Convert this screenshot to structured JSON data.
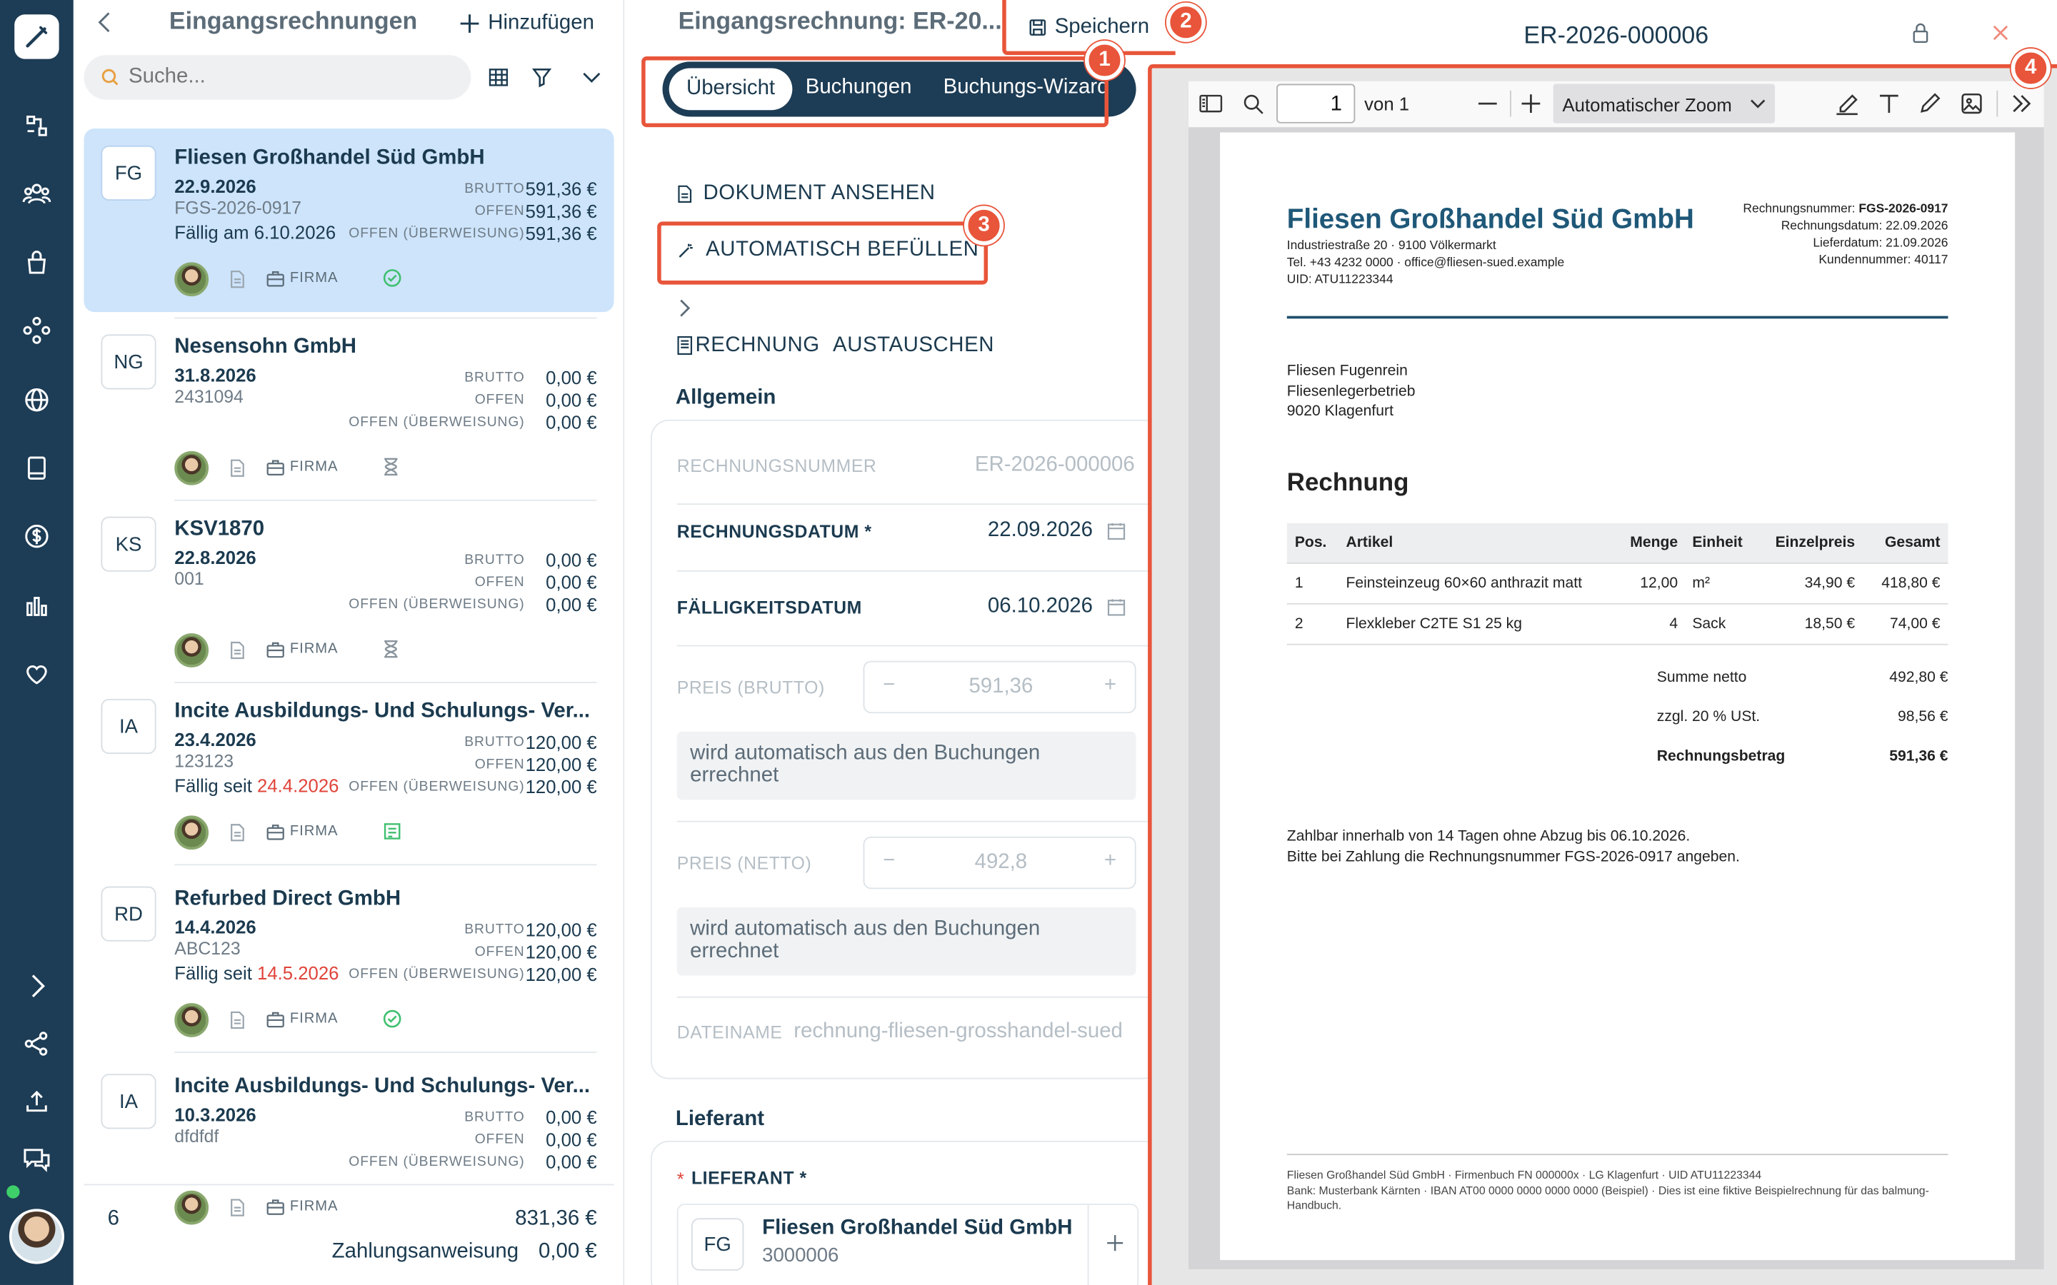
{
  "list": {
    "title": "Eingangsrechnungen",
    "add_label": "Hinzufügen",
    "search_placeholder": "Suche...",
    "items": [
      {
        "mono": "FG",
        "name": "Fliesen Großhandel Süd GmbH",
        "date": "22.9.2026",
        "number": "FGS-2026-0917",
        "due_prefix": "Fällig am 6.10.2026",
        "due_date": "",
        "brutto": "591,36 €",
        "offen": "591,36 €",
        "ueberweisung": "591,36 €",
        "tag": "FIRMA",
        "status": "check-circle-icon"
      },
      {
        "mono": "NG",
        "name": "Nesensohn GmbH",
        "date": "31.8.2026",
        "number": "2431094",
        "due_prefix": "",
        "due_date": "",
        "brutto": "0,00 €",
        "offen": "0,00 €",
        "ueberweisung": "0,00 €",
        "tag": "FIRMA",
        "status": "hourglass-icon"
      },
      {
        "mono": "KS",
        "name": "KSV1870",
        "date": "22.8.2026",
        "number": "001",
        "due_prefix": "",
        "due_date": "",
        "brutto": "0,00 €",
        "offen": "0,00 €",
        "ueberweisung": "0,00 €",
        "tag": "FIRMA",
        "status": "hourglass-icon"
      },
      {
        "mono": "IA",
        "name": "Incite Ausbildungs- Und Schulungs- Ver...",
        "date": "23.4.2026",
        "number": "123123",
        "due_prefix": "Fällig seit ",
        "due_date": "24.4.2026",
        "brutto": "120,00 €",
        "offen": "120,00 €",
        "ueberweisung": "120,00 €",
        "tag": "FIRMA",
        "status": "booked-icon"
      },
      {
        "mono": "RD",
        "name": "Refurbed Direct GmbH",
        "date": "14.4.2026",
        "number": "ABC123",
        "due_prefix": "Fällig seit ",
        "due_date": "14.5.2026",
        "brutto": "120,00 €",
        "offen": "120,00 €",
        "ueberweisung": "120,00 €",
        "tag": "FIRMA",
        "status": "check-circle-icon"
      },
      {
        "mono": "IA",
        "name": "Incite Ausbildungs- Und Schulungs- Ver...",
        "date": "10.3.2026",
        "number": "dfdfdf",
        "due_prefix": "",
        "due_date": "",
        "brutto": "0,00 €",
        "offen": "0,00 €",
        "ueberweisung": "0,00 €",
        "tag": "FIRMA",
        "status": ""
      }
    ],
    "amount_labels": {
      "brutto": "BRUTTO",
      "offen": "OFFEN",
      "ueberweisung": "OFFEN (ÜBERWEISUNG)"
    },
    "footer": {
      "count": "6",
      "total": "831,36 €",
      "payment_label": "Zahlungsanweisung",
      "payment_value": "0,00 €"
    }
  },
  "detail": {
    "title": "Eingangsrechnung: ER-20...",
    "save_label": "Speichern",
    "tabs": [
      "Übersicht",
      "Buchungen",
      "Buchungs-Wizard"
    ],
    "active_tab": "Übersicht",
    "actions": {
      "view_document": "DOKUMENT ANSEHEN",
      "autofill": "AUTOMATISCH BEFÜLLEN",
      "replace_1": "RECHNUNG",
      "replace_2": "AUSTAUSCHEN"
    },
    "section_general": "Allgemein",
    "fields": {
      "invoice_number_label": "RECHNUNGSNUMMER",
      "invoice_number": "ER-2026-000006",
      "invoice_date_label": "RECHNUNGSDATUM *",
      "invoice_date": "22.09.2026",
      "due_date_label": "FÄLLIGKEITSDATUM",
      "due_date": "06.10.2026",
      "gross_label": "PREIS (BRUTTO)",
      "gross": "591,36",
      "net_label": "PREIS (NETTO)",
      "net": "492,8",
      "auto_hint": "wird automatisch aus den Buchungen errechnet",
      "filename_label": "DATEINAME",
      "filename": "rechnung-fliesen-grosshandel-sued"
    },
    "section_supplier": "Lieferant",
    "supplier_label": "LIEFERANT *",
    "supplier": {
      "mono": "FG",
      "name": "Fliesen Großhandel Süd GmbH",
      "number": "3000006"
    }
  },
  "annotations": [
    "1",
    "2",
    "3",
    "4"
  ],
  "viewer": {
    "title": "ER-2026-000006",
    "page_input": "1",
    "page_of": "von 1",
    "zoom": "Automatischer Zoom"
  },
  "invoice": {
    "company": "Fliesen Großhandel Süd GmbH",
    "address": "Industriestraße 20 · 9100 Völkermarkt",
    "contact": "Tel. +43 4232 0000 · office@fliesen-sued.example",
    "uid": "UID: ATU11223344",
    "meta": [
      {
        "label": "Rechnungsnummer: ",
        "value": "FGS-2026-0917"
      },
      {
        "label": "Rechnungsdatum: ",
        "value": "22.09.2026"
      },
      {
        "label": "Lieferdatum: ",
        "value": "21.09.2026"
      },
      {
        "label": "Kundennummer: ",
        "value": "40117"
      }
    ],
    "recipient": [
      "Fliesen Fugenrein",
      "Fliesenlegerbetrieb",
      "9020 Klagenfurt"
    ],
    "heading": "Rechnung",
    "columns": [
      "Pos.",
      "Artikel",
      "Menge",
      "Einheit",
      "Einzelpreis",
      "Gesamt"
    ],
    "rows": [
      [
        "1",
        "Feinsteinzeug 60×60 anthrazit matt",
        "12,00",
        "m²",
        "34,90 €",
        "418,80 €"
      ],
      [
        "2",
        "Flexkleber C2TE S1 25 kg",
        "4",
        "Sack",
        "18,50 €",
        "74,00 €"
      ]
    ],
    "totals": [
      {
        "label": "Summe netto",
        "value": "492,80 €"
      },
      {
        "label": "zzgl. 20 % USt.",
        "value": "98,56 €"
      },
      {
        "label": "Rechnungsbetrag",
        "value": "591,36 €"
      }
    ],
    "payment_terms": [
      "Zahlbar innerhalb von 14 Tagen ohne Abzug bis 06.10.2026.",
      "Bitte bei Zahlung die Rechnungsnummer FGS-2026-0917 angeben."
    ],
    "footer": [
      "Fliesen Großhandel Süd GmbH · Firmenbuch FN 000000x · LG Klagenfurt · UID ATU11223344",
      "Bank: Musterbank Kärnten · IBAN AT00 0000 0000 0000 0000 (Beispiel) · Dies ist eine fiktive Beispielrechnung für das balmung-",
      "Handbuch."
    ]
  },
  "colors": {
    "rail": "#1d3c55",
    "selected": "#cde4fb",
    "accent": "#e8553a",
    "text": "#1b3a4f",
    "overdue": "#e0443a"
  }
}
